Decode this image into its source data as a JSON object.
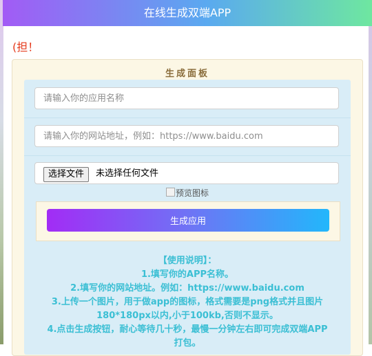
{
  "header": {
    "title": "在线生成双端APP"
  },
  "notice": {
    "text": "(担！"
  },
  "panel": {
    "title": "生成面板",
    "app_name_placeholder": "请输入你的应用名称",
    "site_url_placeholder": "请输入你的网站地址，例如：https://www.baidu.com",
    "file_button_label": "选择文件",
    "file_status": "未选择任何文件",
    "preview_alt": "预览图标",
    "generate_button_label": "生成应用"
  },
  "instructions": {
    "lines": [
      "【使用说明】：",
      "1.填写你的APP名称。",
      "2.填写你的网站地址。例如：https://www.baidu.com",
      "3.上传一个图片，用于做app的图标，格式需要是png格式并且图片",
      "180*180px以内,小于100kb,否则不显示。",
      "4.点击生成按钮，耐心等待几十秒，最慢一分钟左右即可完成双端APP",
      "打包。"
    ]
  },
  "colors": {
    "header_gradient": [
      "#a25bf5",
      "#5aa9f0",
      "#6ee7a0"
    ],
    "notice_red": "#e53a1c",
    "panel_bg": "#fcf7e5",
    "form_bg": "#d9edf7",
    "instruction_text": "#3bbfd4",
    "button_gradient": [
      "#a22cf5",
      "#22b7fb"
    ]
  }
}
